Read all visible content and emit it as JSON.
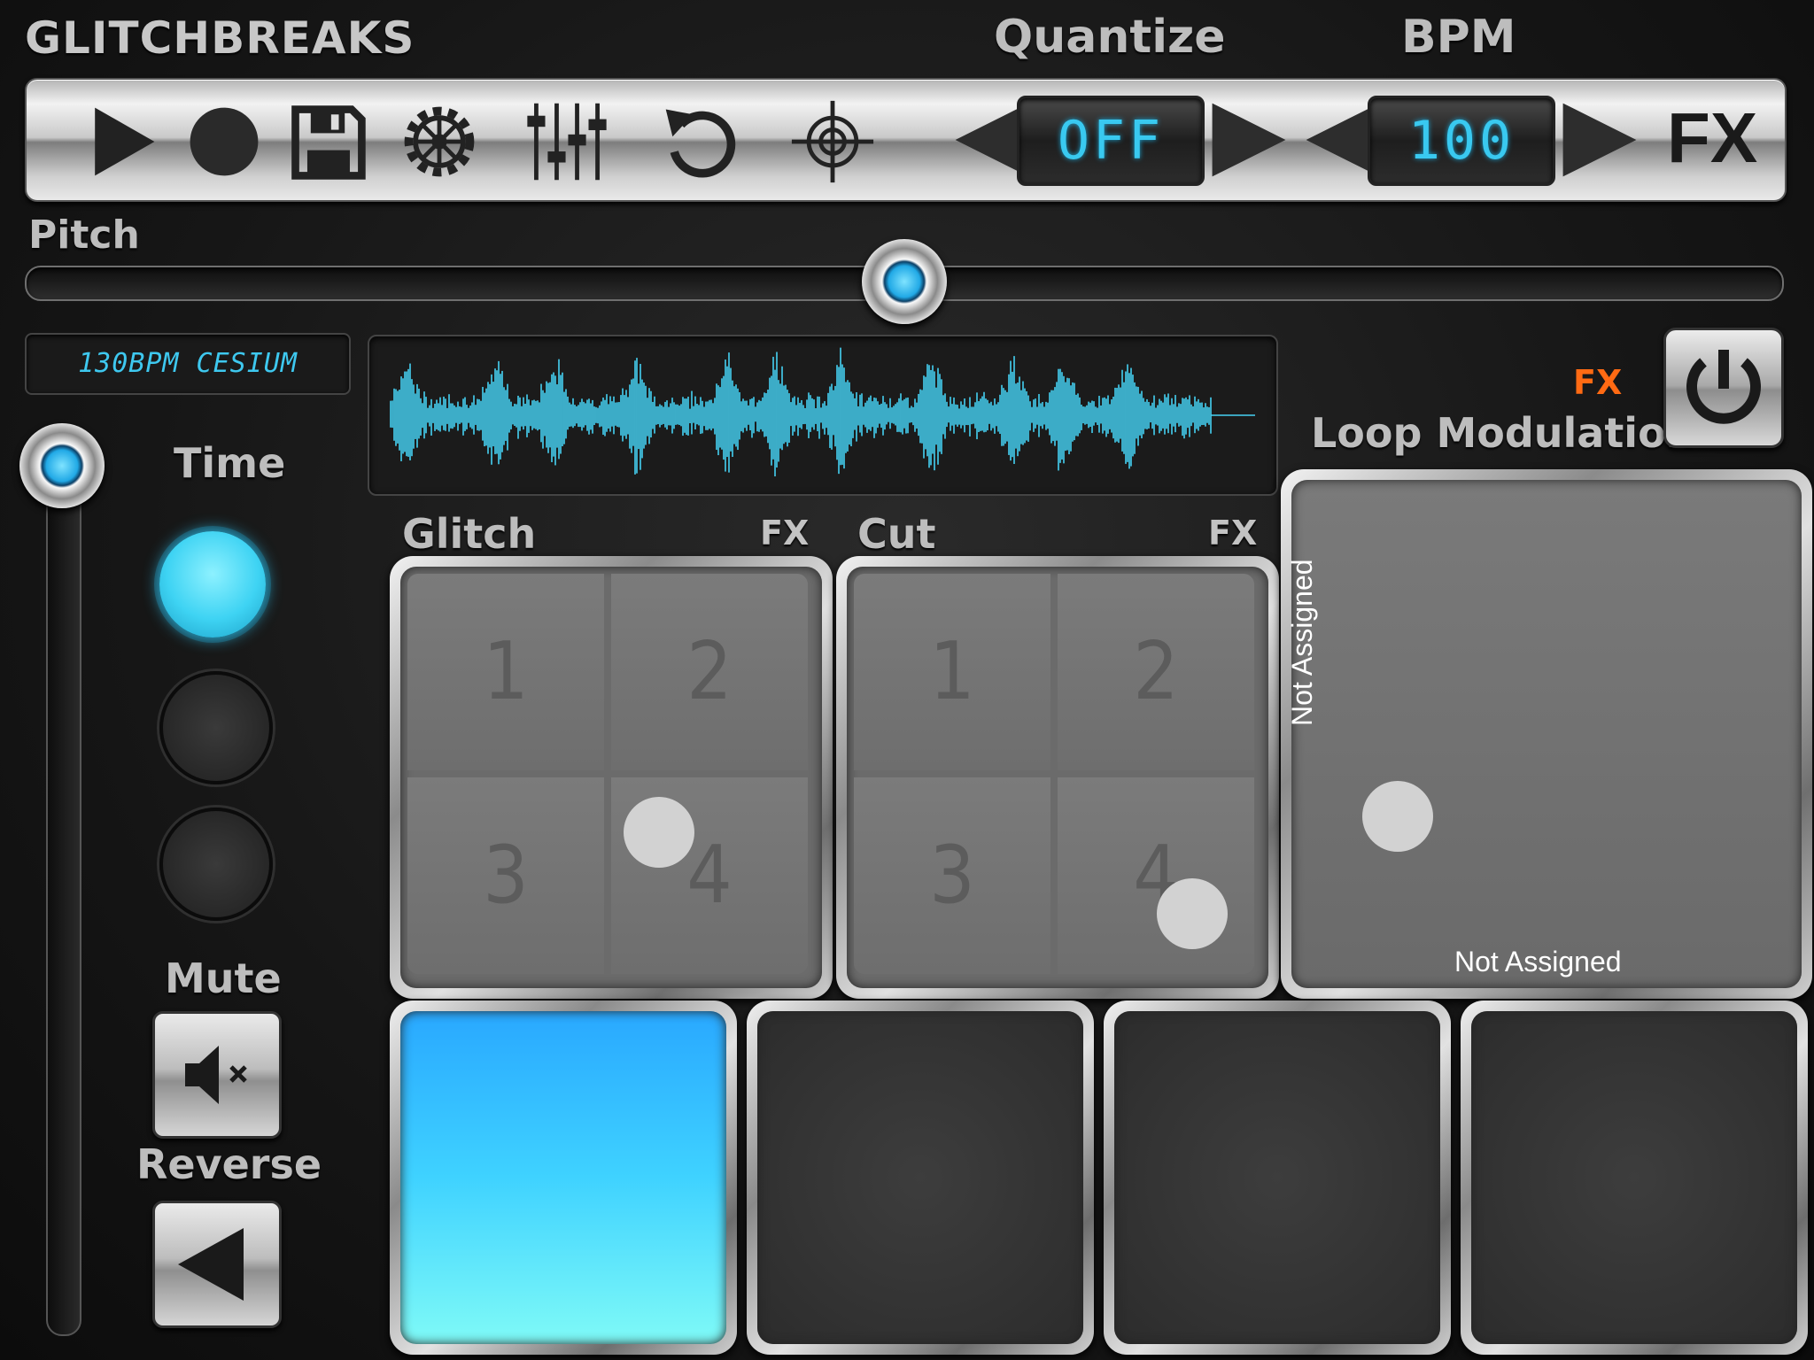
{
  "app": {
    "title": "GLITCHBREAKS"
  },
  "header": {
    "quantize_label": "Quantize",
    "bpm_label": "BPM"
  },
  "toolbar": {
    "icons": [
      "play-icon",
      "record-icon",
      "save-icon",
      "settings-gear-icon",
      "mixer-sliders-icon",
      "undo-icon",
      "target-icon"
    ],
    "quantize_value": "OFF",
    "bpm_value": "100",
    "fx_label": "FX"
  },
  "pitch": {
    "label": "Pitch",
    "value_fraction": 0.5
  },
  "sample": {
    "name": "130BPM CESIUM"
  },
  "time": {
    "label": "Time",
    "selected_index": 0
  },
  "mute": {
    "label": "Mute"
  },
  "reverse": {
    "label": "Reverse"
  },
  "glitch": {
    "label": "Glitch",
    "fx_label": "FX",
    "cells": [
      "1",
      "2",
      "3",
      "4"
    ]
  },
  "cut": {
    "label": "Cut",
    "fx_label": "FX",
    "cells": [
      "1",
      "2",
      "3",
      "4"
    ]
  },
  "loop_modulation": {
    "label": "Loop Modulation",
    "fx_label": "FX",
    "x_axis_label": "Not Assigned",
    "y_axis_label": "Not Assigned"
  },
  "bottom_pads": {
    "active_index": 0,
    "count": 4
  },
  "colors": {
    "accent": "#3ec8ef",
    "fx_orange": "#ff6a13",
    "pad_active": "#3fd2ff"
  }
}
